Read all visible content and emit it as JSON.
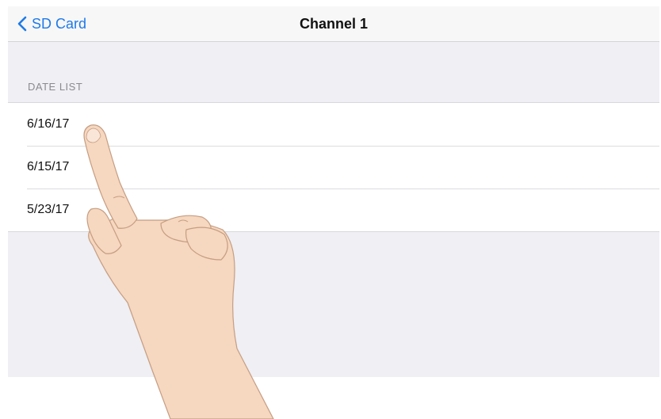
{
  "navbar": {
    "back_label": "SD Card",
    "title": "Channel 1"
  },
  "section": {
    "header": "DATE LIST"
  },
  "dates": [
    "6/16/17",
    "6/15/17",
    "5/23/17"
  ],
  "colors": {
    "accent": "#1f7ae8",
    "background": "#efeff4",
    "skin": "#f6d7bf"
  },
  "icons": {
    "back": "chevron-left-icon",
    "pointer": "pointing-hand-icon"
  }
}
